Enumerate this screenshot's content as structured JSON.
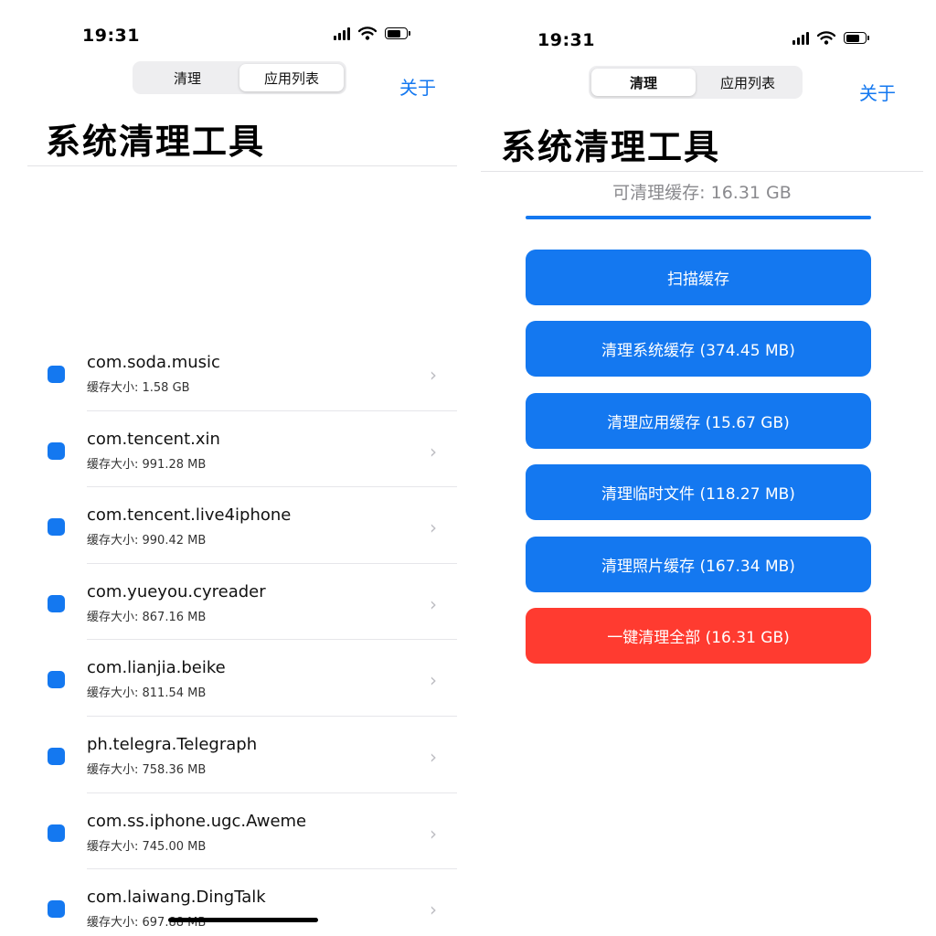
{
  "colors": {
    "accent": "#1478f0",
    "danger": "#ff3b30",
    "app_dot": "#1478f0"
  },
  "left": {
    "status": {
      "time": "19:31"
    },
    "segments": [
      {
        "label": "清理",
        "active": false
      },
      {
        "label": "应用列表",
        "active": true
      }
    ],
    "about": "关于",
    "title": "系统清理工具",
    "apps": [
      {
        "name": "com.soda.music",
        "size": "缓存大小: 1.58 GB"
      },
      {
        "name": "com.tencent.xin",
        "size": "缓存大小: 991.28 MB"
      },
      {
        "name": "com.tencent.live4iphone",
        "size": "缓存大小: 990.42 MB"
      },
      {
        "name": "com.yueyou.cyreader",
        "size": "缓存大小: 867.16 MB"
      },
      {
        "name": "com.lianjia.beike",
        "size": "缓存大小: 811.54 MB"
      },
      {
        "name": "ph.telegra.Telegraph",
        "size": "缓存大小: 758.36 MB"
      },
      {
        "name": "com.ss.iphone.ugc.Aweme",
        "size": "缓存大小: 745.00 MB"
      },
      {
        "name": "com.laiwang.DingTalk",
        "size": "缓存大小: 697.88 MB"
      }
    ]
  },
  "right": {
    "status": {
      "time": "19:31"
    },
    "segments": [
      {
        "label": "清理",
        "active": true
      },
      {
        "label": "应用列表",
        "active": false
      }
    ],
    "about": "关于",
    "title": "系统清理工具",
    "cache_text": "可清理缓存: 16.31 GB",
    "progress": 1.0,
    "buttons": {
      "scan": "扫描缓存",
      "system": "清理系统缓存 (374.45 MB)",
      "app": "清理应用缓存 (15.67 GB)",
      "temp": "清理临时文件 (118.27 MB)",
      "photo": "清理照片缓存 (167.34 MB)",
      "all": "一键清理全部 (16.31 GB)"
    }
  }
}
